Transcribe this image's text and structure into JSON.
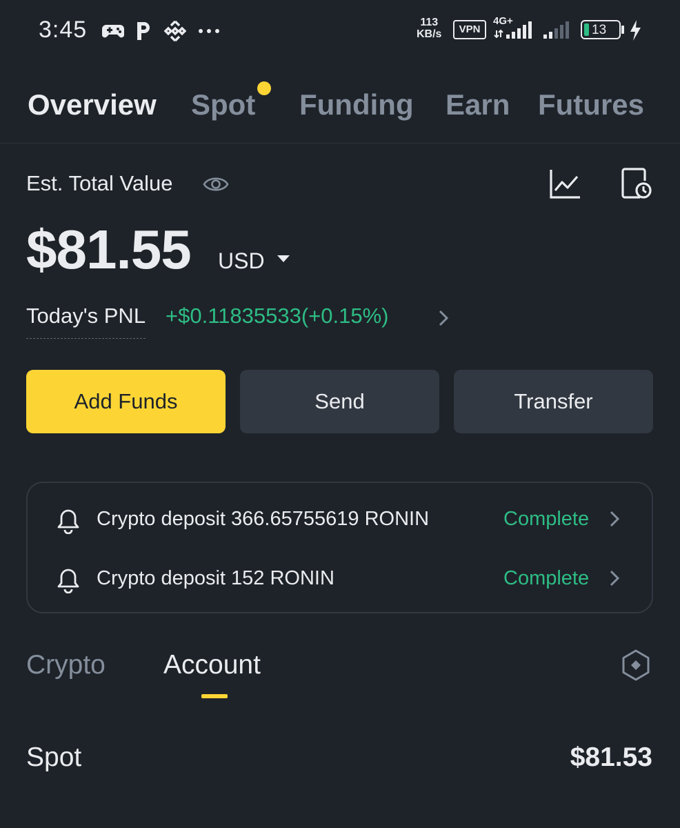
{
  "status_bar": {
    "time": "3:45",
    "speed_value": "113",
    "speed_unit": "KB/s",
    "vpn": "VPN",
    "network": "4G+",
    "battery": "13"
  },
  "tabs": [
    {
      "label": "Overview",
      "active": true
    },
    {
      "label": "Spot",
      "active": false
    },
    {
      "label": "Funding",
      "active": false
    },
    {
      "label": "Earn",
      "active": false
    },
    {
      "label": "Futures",
      "active": false
    }
  ],
  "summary": {
    "est_label": "Est. Total Value",
    "total": "$81.55",
    "currency": "USD",
    "pnl_label": "Today's PNL",
    "pnl_value": "+$0.11835533(+0.15%)"
  },
  "actions": {
    "add_funds": "Add Funds",
    "send": "Send",
    "transfer": "Transfer"
  },
  "notifications": [
    {
      "text": "Crypto deposit 366.65755619 RONIN",
      "status": "Complete"
    },
    {
      "text": "Crypto deposit 152 RONIN",
      "status": "Complete"
    }
  ],
  "subtabs": [
    {
      "label": "Crypto",
      "active": false
    },
    {
      "label": "Account",
      "active": true
    }
  ],
  "accounts": [
    {
      "name": "Spot",
      "value": "$81.53"
    }
  ],
  "colors": {
    "background": "#1e2329",
    "accent": "#fcd535",
    "positive": "#2ebd85",
    "muted": "#848e9c"
  },
  "icons": [
    "game-controller-icon",
    "p-app-icon",
    "binance-icon",
    "more-dots-icon",
    "eye-icon",
    "chart-icon",
    "history-icon",
    "bell-icon",
    "chevron-right-icon",
    "settings-hexagon-icon",
    "signal-icon",
    "battery-icon",
    "bolt-icon"
  ]
}
